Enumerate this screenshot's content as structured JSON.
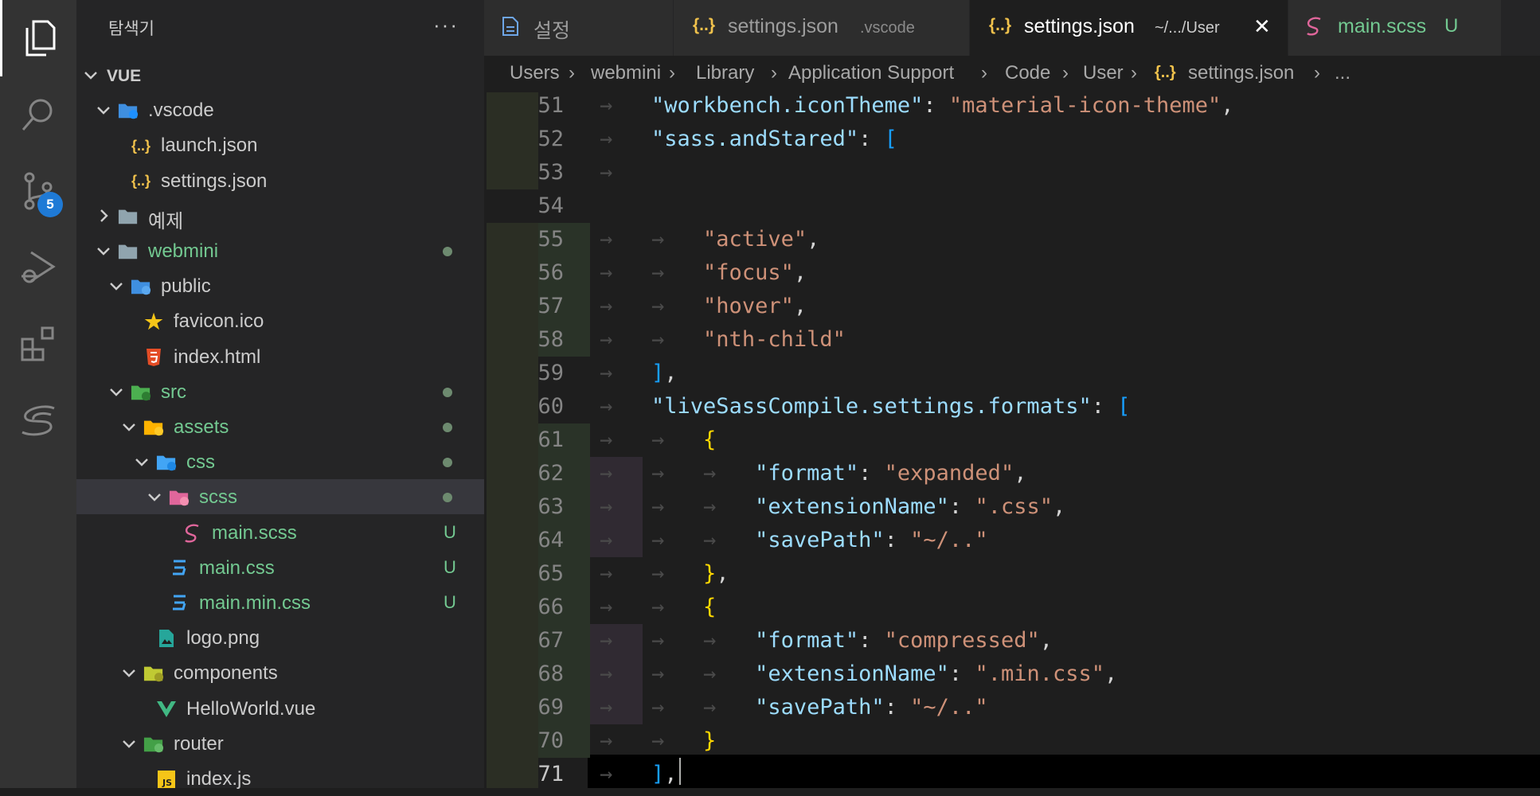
{
  "activity_bar": {
    "items": [
      {
        "name": "explorer-icon",
        "active": true
      },
      {
        "name": "search-icon",
        "active": false
      },
      {
        "name": "source-control-icon",
        "active": false,
        "badge": "5"
      },
      {
        "name": "run-debug-icon",
        "active": false
      },
      {
        "name": "extensions-icon",
        "active": false
      },
      {
        "name": "sass-icon",
        "active": false
      }
    ]
  },
  "sidebar": {
    "title": "탐색기",
    "more": "···",
    "tree": [
      {
        "label": "VUE",
        "depth": 0,
        "type": "root",
        "expanded": true
      },
      {
        "label": ".vscode",
        "depth": 1,
        "type": "folder-vscode",
        "expanded": true
      },
      {
        "label": "launch.json",
        "depth": 2,
        "type": "json"
      },
      {
        "label": "settings.json",
        "depth": 2,
        "type": "json"
      },
      {
        "label": "예제",
        "depth": 1,
        "type": "folder",
        "expanded": false
      },
      {
        "label": "webmini",
        "depth": 1,
        "type": "folder",
        "expanded": true,
        "modified_dot": true,
        "green": true
      },
      {
        "label": "public",
        "depth": 2,
        "type": "folder-public",
        "expanded": true
      },
      {
        "label": "favicon.ico",
        "depth": 3,
        "type": "favicon"
      },
      {
        "label": "index.html",
        "depth": 3,
        "type": "html"
      },
      {
        "label": "src",
        "depth": 2,
        "type": "folder-src",
        "expanded": true,
        "modified_dot": true,
        "green": true
      },
      {
        "label": "assets",
        "depth": 3,
        "type": "folder-assets",
        "expanded": true,
        "modified_dot": true,
        "green": true
      },
      {
        "label": "css",
        "depth": 4,
        "type": "folder-css",
        "expanded": true,
        "modified_dot": true,
        "green": true
      },
      {
        "label": "scss",
        "depth": 5,
        "type": "folder-scss",
        "expanded": true,
        "modified_dot": true,
        "green": true,
        "selected": true
      },
      {
        "label": "main.scss",
        "depth": 6,
        "type": "scss",
        "untracked": "U",
        "green": true
      },
      {
        "label": "main.css",
        "depth": 5,
        "type": "css",
        "untracked": "U",
        "green": true
      },
      {
        "label": "main.min.css",
        "depth": 5,
        "type": "css",
        "untracked": "U",
        "green": true
      },
      {
        "label": "logo.png",
        "depth": 4,
        "type": "image"
      },
      {
        "label": "components",
        "depth": 3,
        "type": "folder-components",
        "expanded": true
      },
      {
        "label": "HelloWorld.vue",
        "depth": 4,
        "type": "vue"
      },
      {
        "label": "router",
        "depth": 3,
        "type": "folder-router",
        "expanded": true
      },
      {
        "label": "index.js",
        "depth": 4,
        "type": "js"
      }
    ]
  },
  "tabs": [
    {
      "label": "설정",
      "desc": "",
      "icon": "settings-file-icon",
      "active": false
    },
    {
      "label": "settings.json",
      "desc": ".vscode",
      "icon": "json-icon",
      "active": false
    },
    {
      "label": "settings.json",
      "desc": "~/.../User",
      "icon": "json-icon",
      "active": true,
      "close": "✕"
    },
    {
      "label": "main.scss",
      "desc": "U",
      "icon": "sass-icon",
      "active": false,
      "green": true
    }
  ],
  "breadcrumb": [
    "Users",
    "webmini",
    "Library",
    "Application Support",
    "Code",
    "User",
    "settings.json",
    "..."
  ],
  "editor": {
    "current_line": "71",
    "lines": [
      {
        "n": "51",
        "indent": 1,
        "tokens": [
          [
            "k",
            "\"workbench.iconTheme\""
          ],
          [
            "p",
            ": "
          ],
          [
            "s",
            "\"material-icon-theme\""
          ],
          [
            "p",
            ","
          ]
        ]
      },
      {
        "n": "52",
        "indent": 1,
        "tokens": [
          [
            "k",
            "\"sass.andStared\""
          ],
          [
            "p",
            ": "
          ],
          [
            "b2",
            "["
          ]
        ]
      },
      {
        "n": "53",
        "indent": 1,
        "tokens": []
      },
      {
        "n": "54",
        "indent": 0,
        "tokens": []
      },
      {
        "n": "55",
        "indent": 2,
        "tokens": [
          [
            "s",
            "\"active\""
          ],
          [
            "p",
            ","
          ]
        ]
      },
      {
        "n": "56",
        "indent": 2,
        "tokens": [
          [
            "s",
            "\"focus\""
          ],
          [
            "p",
            ","
          ]
        ]
      },
      {
        "n": "57",
        "indent": 2,
        "tokens": [
          [
            "s",
            "\"hover\""
          ],
          [
            "p",
            ","
          ]
        ]
      },
      {
        "n": "58",
        "indent": 2,
        "tokens": [
          [
            "s",
            "\"nth-child\""
          ]
        ]
      },
      {
        "n": "59",
        "indent": 1,
        "tokens": [
          [
            "b2",
            "]"
          ],
          [
            "p",
            ","
          ]
        ]
      },
      {
        "n": "60",
        "indent": 1,
        "tokens": [
          [
            "k",
            "\"liveSassCompile.settings.formats\""
          ],
          [
            "p",
            ": "
          ],
          [
            "b2",
            "["
          ]
        ]
      },
      {
        "n": "61",
        "indent": 2,
        "tokens": [
          [
            "b1",
            "{"
          ]
        ]
      },
      {
        "n": "62",
        "indent": 3,
        "tokens": [
          [
            "k",
            "\"format\""
          ],
          [
            "p",
            ": "
          ],
          [
            "s",
            "\"expanded\""
          ],
          [
            "p",
            ","
          ]
        ]
      },
      {
        "n": "63",
        "indent": 3,
        "tokens": [
          [
            "k",
            "\"extensionName\""
          ],
          [
            "p",
            ": "
          ],
          [
            "s",
            "\".css\""
          ],
          [
            "p",
            ","
          ]
        ]
      },
      {
        "n": "64",
        "indent": 3,
        "tokens": [
          [
            "k",
            "\"savePath\""
          ],
          [
            "p",
            ": "
          ],
          [
            "s",
            "\"~/..\""
          ]
        ]
      },
      {
        "n": "65",
        "indent": 2,
        "tokens": [
          [
            "b1",
            "}"
          ],
          [
            "p",
            ","
          ]
        ]
      },
      {
        "n": "66",
        "indent": 2,
        "tokens": [
          [
            "b1",
            "{"
          ]
        ]
      },
      {
        "n": "67",
        "indent": 3,
        "tokens": [
          [
            "k",
            "\"format\""
          ],
          [
            "p",
            ": "
          ],
          [
            "s",
            "\"compressed\""
          ],
          [
            "p",
            ","
          ]
        ]
      },
      {
        "n": "68",
        "indent": 3,
        "tokens": [
          [
            "k",
            "\"extensionName\""
          ],
          [
            "p",
            ": "
          ],
          [
            "s",
            "\".min.css\""
          ],
          [
            "p",
            ","
          ]
        ]
      },
      {
        "n": "69",
        "indent": 3,
        "tokens": [
          [
            "k",
            "\"savePath\""
          ],
          [
            "p",
            ": "
          ],
          [
            "s",
            "\"~/..\""
          ]
        ]
      },
      {
        "n": "70",
        "indent": 2,
        "tokens": [
          [
            "b1",
            "}"
          ]
        ]
      },
      {
        "n": "71",
        "indent": 1,
        "tokens": [
          [
            "b2",
            "]"
          ],
          [
            "p",
            ","
          ]
        ]
      }
    ]
  },
  "colors": {
    "accent_green": "#73c991",
    "badge_blue": "#1f7ad6",
    "json_icon": "#f1c24c",
    "sass_pink": "#e0669b",
    "html_orange": "#e44d26",
    "css_blue": "#42a5f5",
    "vue_green": "#41b883"
  }
}
